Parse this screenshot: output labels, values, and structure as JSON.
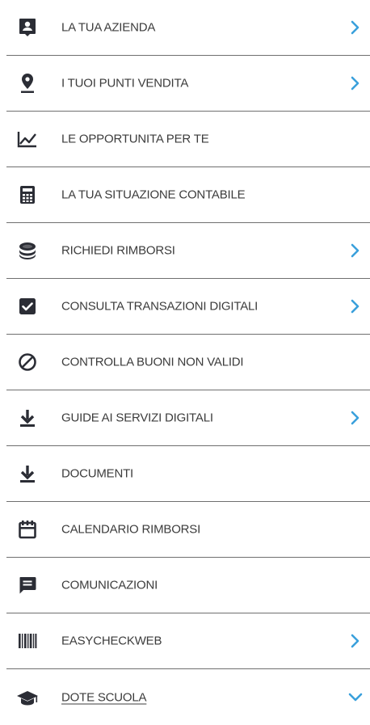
{
  "colors": {
    "icon": "#2b2d35",
    "text": "#3c3c3c",
    "divider": "#6f6f6f",
    "chevron": "#3aa0dc"
  },
  "menu": {
    "items": [
      {
        "label": "LA TUA AZIENDA",
        "icon": "account-box-icon",
        "chevron": "right"
      },
      {
        "label": "I TUOI PUNTI VENDITA",
        "icon": "map-pin-icon",
        "chevron": "right"
      },
      {
        "label": "LE OPPORTUNITA PER TE",
        "icon": "trending-chart-icon",
        "chevron": ""
      },
      {
        "label": "LA TUA SITUAZIONE CONTABILE",
        "icon": "calculator-icon",
        "chevron": ""
      },
      {
        "label": "RICHIEDI RIMBORSI",
        "icon": "coins-icon",
        "chevron": "right"
      },
      {
        "label": "CONSULTA TRANSAZIONI DIGITALI",
        "icon": "checkbox-icon",
        "chevron": "right"
      },
      {
        "label": "CONTROLLA BUONI NON VALIDI",
        "icon": "block-icon",
        "chevron": ""
      },
      {
        "label": "GUIDE AI SERVIZI DIGITALI",
        "icon": "download-icon",
        "chevron": "right"
      },
      {
        "label": "DOCUMENTI",
        "icon": "download-icon",
        "chevron": ""
      },
      {
        "label": "CALENDARIO RIMBORSI",
        "icon": "calendar-icon",
        "chevron": ""
      },
      {
        "label": "COMUNICAZIONI",
        "icon": "message-icon",
        "chevron": ""
      },
      {
        "label": "EASYCHECKWEB",
        "icon": "barcode-icon",
        "chevron": "right"
      },
      {
        "label": "DOTE SCUOLA",
        "icon": "graduation-cap-icon",
        "chevron": "down"
      }
    ]
  }
}
